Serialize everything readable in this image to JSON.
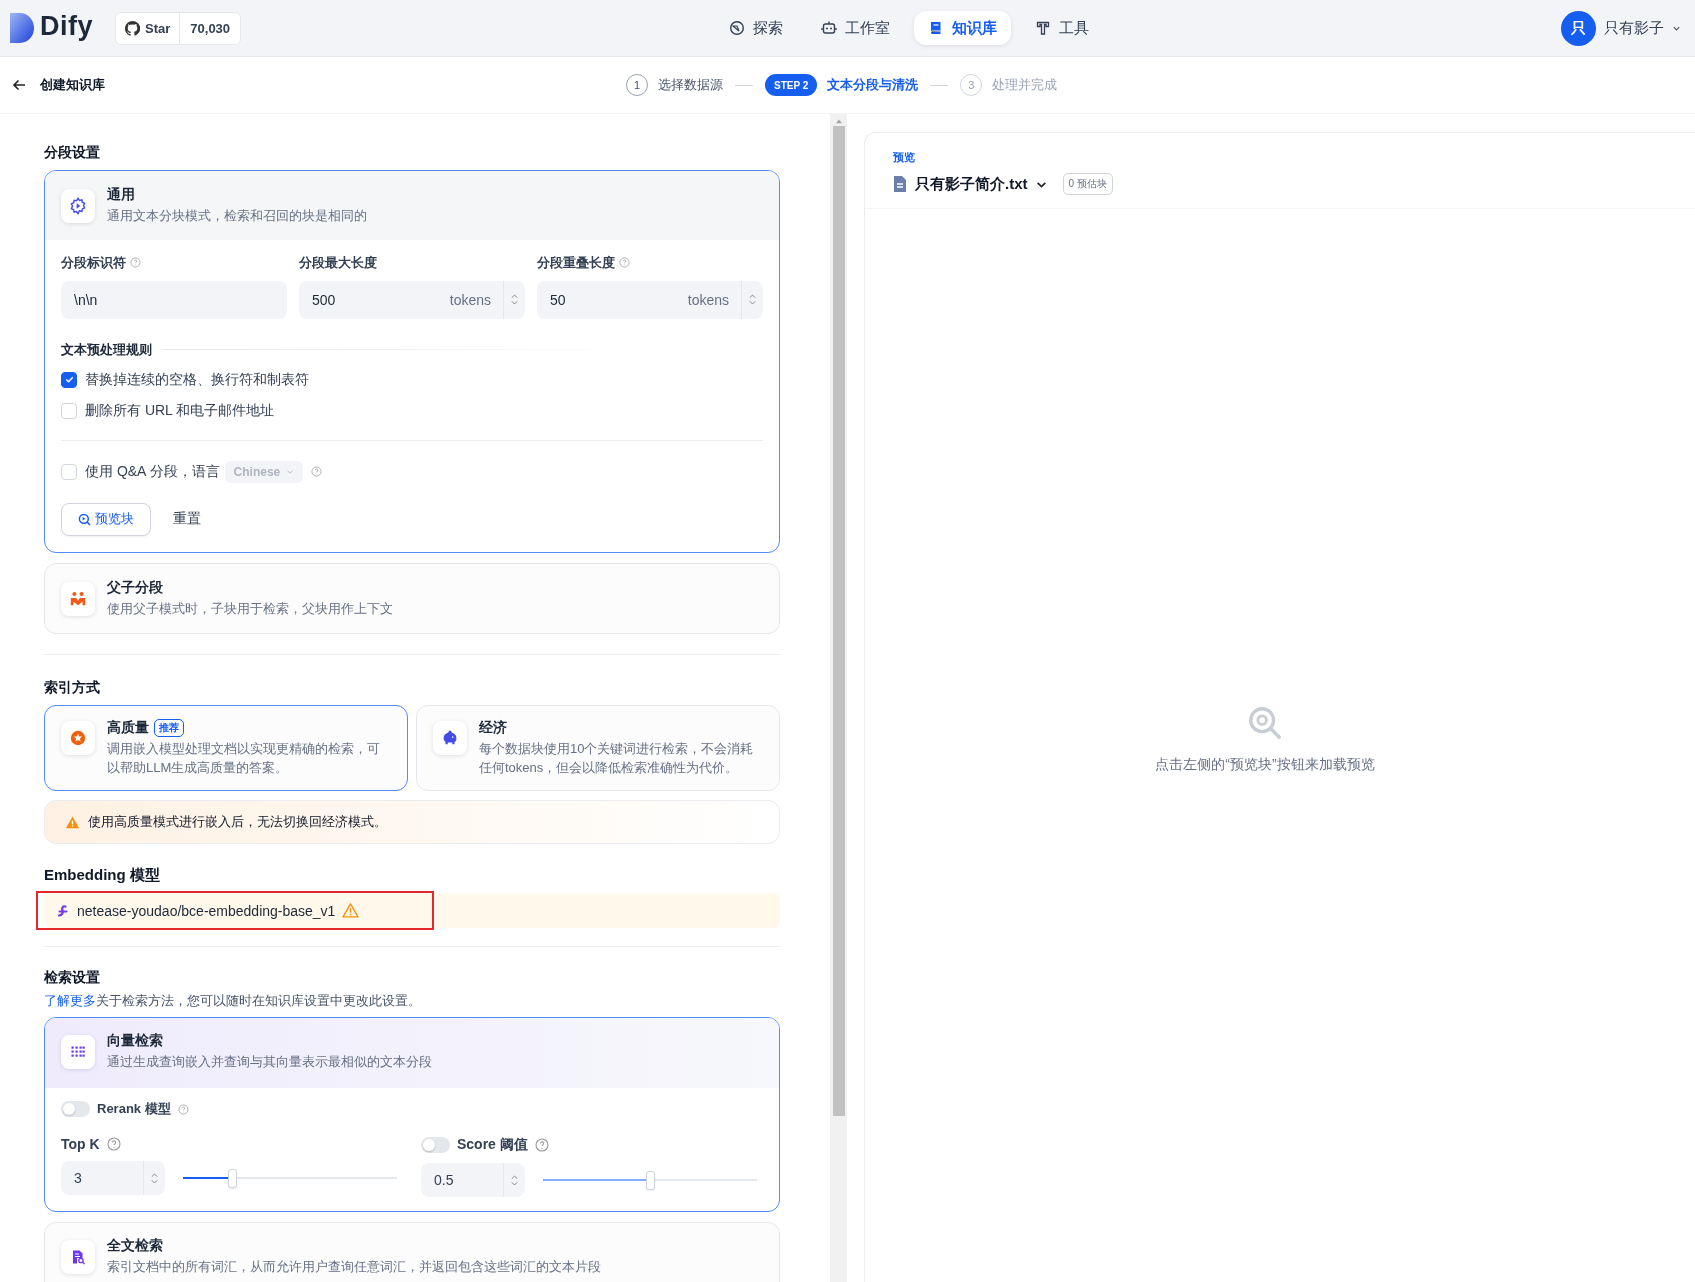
{
  "nav": {
    "logo": "Dify",
    "star_label": "Star",
    "star_count": "70,030",
    "items": [
      {
        "kind": "explore",
        "label": "探索",
        "selected": false
      },
      {
        "kind": "studio",
        "label": "工作室",
        "selected": false
      },
      {
        "kind": "knowledge",
        "label": "知识库",
        "selected": true
      },
      {
        "kind": "tools",
        "label": "工具",
        "selected": false
      }
    ],
    "user": {
      "avatar": "只",
      "name": "只有影子"
    }
  },
  "subheader": {
    "title": "创建知识库",
    "steps": [
      {
        "number": "1",
        "label": "选择数据源",
        "selected": false,
        "reached": true
      },
      {
        "number": "STEP 2",
        "label": "文本分段与清洗",
        "selected": true,
        "reached": true
      },
      {
        "number": "3",
        "label": "处理并完成",
        "selected": false,
        "reached": false
      }
    ]
  },
  "segmentation": {
    "title": "分段设置",
    "modes": [
      {
        "kind": "general",
        "title": "通用",
        "description": "通用文本分块模式，检索和召回的块是相同的",
        "selected": true,
        "fields": [
          {
            "label": "分段标识符",
            "help": true,
            "value": "\\n\\n"
          },
          {
            "label": "分段最大长度",
            "help": false,
            "value": "500",
            "unit": "tokens"
          },
          {
            "label": "分段重叠长度",
            "help": true,
            "value": "50",
            "unit": "tokens"
          }
        ],
        "rules_title": "文本预处理规则",
        "rules": [
          {
            "label": "替换掉连续的空格、换行符和制表符",
            "checked": true
          },
          {
            "label": "删除所有 URL 和电子邮件地址",
            "checked": false
          }
        ],
        "qa": {
          "label": "使用 Q&A 分段，语言",
          "checked": false,
          "language": "Chinese"
        },
        "preview_button": "预览块",
        "reset_button": "重置"
      },
      {
        "kind": "parent_child",
        "title": "父子分段",
        "description": "使用父子模式时，子块用于检索，父块用作上下文",
        "selected": false
      }
    ]
  },
  "index": {
    "title": "索引方式",
    "options": [
      {
        "kind": "high_quality",
        "title": "高质量",
        "badge": "推荐",
        "description": "调用嵌入模型处理文档以实现更精确的检索，可以帮助LLM生成高质量的答案。",
        "selected": true
      },
      {
        "kind": "economy",
        "title": "经济",
        "description": "每个数据块使用10个关键词进行检索，不会消耗任何tokens，但会以降低检索准确性为代价。",
        "selected": false
      }
    ],
    "warning": "使用高质量模式进行嵌入后，无法切换回经济模式。"
  },
  "embedding": {
    "title": "Embedding 模型",
    "model": "netease-youdao/bce-embedding-base_v1",
    "warning": true,
    "highlighted": true
  },
  "retrieval": {
    "title": "检索设置",
    "link": "了解更多",
    "note": "关于检索方法，您可以随时在知识库设置中更改此设置。",
    "methods": [
      {
        "kind": "vector",
        "title": "向量检索",
        "description": "通过生成查询嵌入并查询与其向量表示最相似的文本分段",
        "selected": true,
        "rerank": {
          "label": "Rerank 模型",
          "on": false
        },
        "top_k": {
          "label": "Top K",
          "value": "3",
          "level": 0.23
        },
        "score": {
          "label": "Score 阈值",
          "on": false,
          "value": "0.5",
          "level": 0.5
        }
      },
      {
        "kind": "fulltext",
        "title": "全文检索",
        "description": "索引文档中的所有词汇，从而允许用户查询任意词汇，并返回包含这些词汇的文本片段",
        "selected": false
      }
    ]
  },
  "preview": {
    "label": "预览",
    "file": "只有影子简介.txt",
    "count": "0 预估块",
    "empty_text": "点击左侧的“预览块”按钮来加载预览"
  }
}
